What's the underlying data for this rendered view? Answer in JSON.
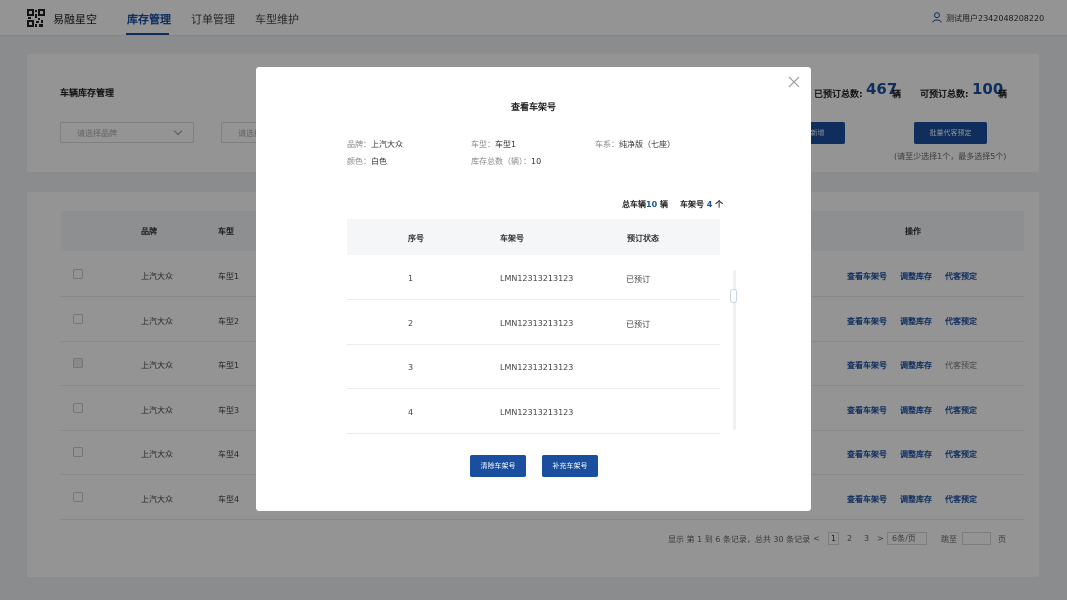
{
  "header": {
    "brand": "易融星空",
    "nav": [
      "库存管理",
      "订单管理",
      "车型维护"
    ],
    "active_nav": "库存管理",
    "user": "测试用户2342048208220"
  },
  "filters": {
    "title": "车辆库存管理",
    "brand_placeholder": "请选择品牌",
    "model_placeholder": "请选择",
    "booked_label": "已预订总数:",
    "booked_value": "467",
    "booked_unit": "辆",
    "available_label": "可预订总数:",
    "available_value": "100",
    "available_unit": "辆",
    "new_button": "新增",
    "batch_button": "批量代客预定",
    "hint": "(请至少选择1个，最多选择5个)"
  },
  "table": {
    "columns": {
      "brand": "品牌",
      "model": "车型",
      "actions": "操作"
    },
    "rows": [
      {
        "brand": "上汽大众",
        "model": "车型1",
        "disabled": false,
        "view": "查看车架号",
        "adjust": "调整库存",
        "book": "代客预定"
      },
      {
        "brand": "上汽大众",
        "model": "车型2",
        "disabled": false,
        "view": "查看车架号",
        "adjust": "调整库存",
        "book": "代客预定"
      },
      {
        "brand": "上汽大众",
        "model": "车型1",
        "disabled": true,
        "view": "查看车架号",
        "adjust": "调整库存",
        "book": "代客预定"
      },
      {
        "brand": "上汽大众",
        "model": "车型3",
        "disabled": false,
        "view": "查看车架号",
        "adjust": "调整库存",
        "book": "代客预定"
      },
      {
        "brand": "上汽大众",
        "model": "车型4",
        "disabled": false,
        "view": "查看车架号",
        "adjust": "调整库存",
        "book": "代客预定"
      },
      {
        "brand": "上汽大众",
        "model": "车型4",
        "disabled": false,
        "view": "查看车架号",
        "adjust": "调整库存",
        "book": "代客预定"
      }
    ]
  },
  "pagination": {
    "summary": "显示 第 1 到 6 条记录，总共 30 条记录",
    "prev": "<",
    "pages": [
      "1",
      "2",
      "3"
    ],
    "next": ">",
    "page_size": "6条/页",
    "jump_label": "跳至",
    "page_unit": "页"
  },
  "modal": {
    "title": "查看车架号",
    "info": {
      "brand_label": "品牌：",
      "brand": "上汽大众",
      "model_label": "车型：",
      "model": "车型1",
      "series_label": "车系：",
      "series": "纯净版（七座）",
      "color_label": "颜色：",
      "color": "白色",
      "stock_label": "库存总数（辆）：",
      "stock": "10"
    },
    "summary": {
      "total_label": "总车辆",
      "total": "10",
      "total_unit": "辆",
      "vin_label": "车架号",
      "vin_count": "4",
      "vin_unit": "个"
    },
    "columns": {
      "index": "序号",
      "vin": "车架号",
      "status": "预订状态"
    },
    "rows": [
      {
        "index": "1",
        "vin": "LMN12313213123",
        "status": "已预订"
      },
      {
        "index": "2",
        "vin": "LMN12313213123",
        "status": "已预订"
      },
      {
        "index": "3",
        "vin": "LMN12313213123",
        "status": ""
      },
      {
        "index": "4",
        "vin": "LMN12313213123",
        "status": ""
      }
    ],
    "clear_button": "清除车架号",
    "add_button": "补充车架号"
  },
  "colors": {
    "primary": "#1a4fa0",
    "overlay": "rgba(0,0,0,0.42)"
  }
}
